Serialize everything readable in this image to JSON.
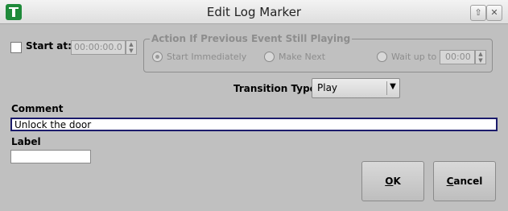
{
  "window": {
    "title": "Edit Log Marker",
    "icons": [
      "app-logo-icon",
      "maximize-icon",
      "close-icon"
    ],
    "maximize_glyph": "⇧",
    "close_glyph": "✕"
  },
  "start_at": {
    "label": "Start at:",
    "checked": false,
    "time_value": "00:00:00.0"
  },
  "previous_event_group": {
    "title": "Action If Previous Event Still Playing",
    "options": [
      {
        "label": "Start Immediately",
        "selected": true
      },
      {
        "label": "Make Next",
        "selected": false
      },
      {
        "label": "Wait up to",
        "selected": false
      }
    ],
    "wait_value": "00:00"
  },
  "transition": {
    "label": "Transition Type:",
    "value": "Play",
    "arrow_glyph": "▼"
  },
  "comment": {
    "label": "Comment",
    "value": "Unlock the door"
  },
  "label_field": {
    "label": "Label",
    "value": ""
  },
  "buttons": {
    "ok": {
      "mnemonic": "O",
      "rest": "K"
    },
    "cancel": {
      "mnemonic": "C",
      "rest": "ancel"
    }
  }
}
